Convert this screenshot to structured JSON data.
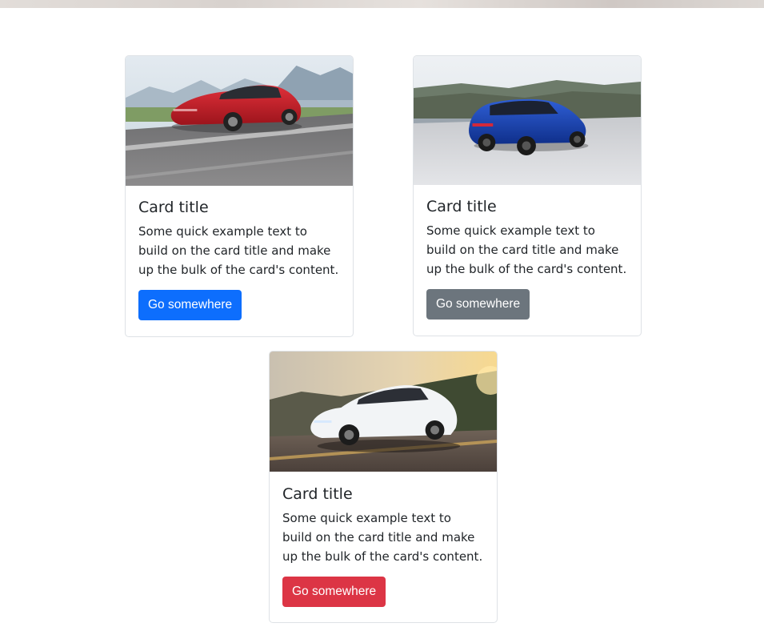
{
  "cards": [
    {
      "title": "Card title",
      "text": "Some quick example text to build on the card title and make up the bulk of the card's content.",
      "button_label": "Go somewhere",
      "button_color": "#0d6efd",
      "image": "red-sedan-photo"
    },
    {
      "title": "Card title",
      "text": "Some quick example text to build on the card title and make up the bulk of the card's content.",
      "button_label": "Go somewhere",
      "button_color": "#6c757d",
      "image": "blue-suv-photo"
    },
    {
      "title": "Card title",
      "text": "Some quick example text to build on the card title and make up the bulk of the card's content.",
      "button_label": "Go somewhere",
      "button_color": "#dc3545",
      "image": "white-suv-photo"
    }
  ]
}
